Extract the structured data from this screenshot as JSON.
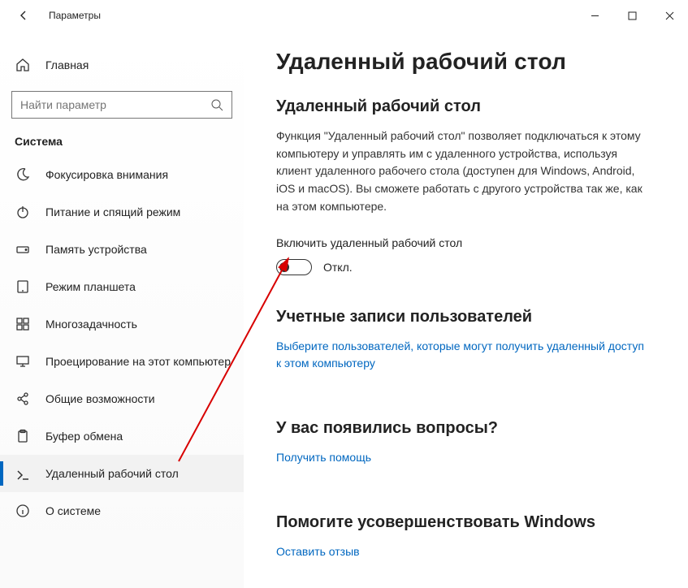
{
  "titlebar": {
    "title": "Параметры"
  },
  "sidebar": {
    "home": "Главная",
    "search_placeholder": "Найти параметр",
    "group": "Система",
    "items": [
      {
        "label": "Фокусировка внимания"
      },
      {
        "label": "Питание и спящий режим"
      },
      {
        "label": "Память устройства"
      },
      {
        "label": "Режим планшета"
      },
      {
        "label": "Многозадачность"
      },
      {
        "label": "Проецирование на этот компьютер"
      },
      {
        "label": "Общие возможности"
      },
      {
        "label": "Буфер обмена"
      },
      {
        "label": "Удаленный рабочий стол"
      },
      {
        "label": "О системе"
      }
    ]
  },
  "main": {
    "h1": "Удаленный рабочий стол",
    "h2a": "Удаленный рабочий стол",
    "desc": "Функция \"Удаленный рабочий стол\" позволяет подключаться к этому компьютеру и управлять им с удаленного устройства, используя клиент удаленного рабочего стола (доступен для Windows, Android, iOS и macOS). Вы сможете работать с другого устройства так же, как на этом компьютере.",
    "toggle_label": "Включить удаленный рабочий стол",
    "toggle_state": "Откл.",
    "h2b": "Учетные записи пользователей",
    "link_users": "Выберите пользователей, которые могут получить удаленный доступ к этом компьютеру",
    "h2c": "У вас появились вопросы?",
    "link_help": "Получить помощь",
    "h2d": "Помогите усовершенствовать Windows",
    "link_feedback": "Оставить отзыв"
  }
}
